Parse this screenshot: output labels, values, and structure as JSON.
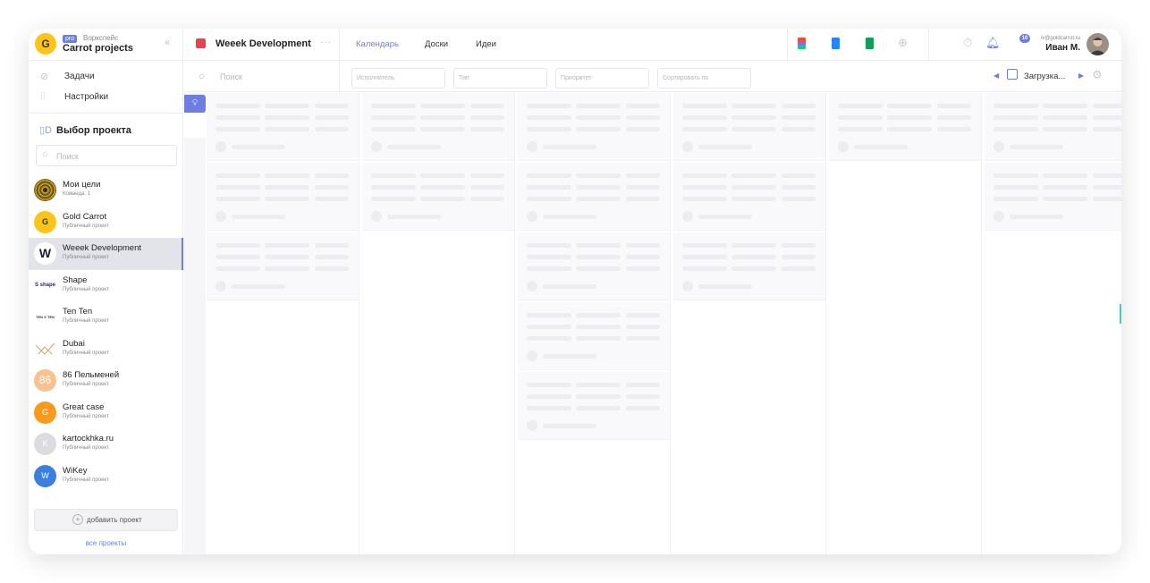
{
  "workspace": {
    "badge": "pro",
    "label": "Воркспейс",
    "name": "Carrot projects",
    "logo_letter": "G",
    "logo_color": "#fcc419"
  },
  "nav": [
    {
      "label": "Задачи",
      "icon": "check-circle-icon"
    },
    {
      "label": "Настройки",
      "icon": "sliders-icon"
    }
  ],
  "projects_section": {
    "title": "Выбор проекта",
    "search_placeholder": "Поиск"
  },
  "projects": [
    {
      "name": "Мои цели",
      "subtitle": "Команда: 1",
      "avatar_text": "",
      "avatar_color": "#3a3010"
    },
    {
      "name": "Gold Carrot",
      "subtitle": "Публичный проект",
      "avatar_text": "G",
      "avatar_color": "#fcc419"
    },
    {
      "name": "Weeek Development",
      "subtitle": "Публичный проект",
      "avatar_text": "W",
      "avatar_color": "#ffffff",
      "active": true
    },
    {
      "name": "Shape",
      "subtitle": "Публичный проект",
      "avatar_text": "S shape",
      "avatar_color": "#ffffff"
    },
    {
      "name": "Ten Ten",
      "subtitle": "Публичный проект",
      "avatar_text": "TEN X TEN",
      "avatar_color": "#ffffff"
    },
    {
      "name": "Dubai",
      "subtitle": "Публичный проект",
      "avatar_text": "",
      "avatar_color": "#ffffff"
    },
    {
      "name": "86 Пельменей",
      "subtitle": "Публичный проект",
      "avatar_text": "86",
      "avatar_color": "#f7c28f"
    },
    {
      "name": "Great case",
      "subtitle": "Публичный проект",
      "avatar_text": "G",
      "avatar_color": "#f99a1c"
    },
    {
      "name": "kartockhka.ru",
      "subtitle": "Публичный проект",
      "avatar_text": "K",
      "avatar_color": "#dcdce0"
    },
    {
      "name": "WiKey",
      "subtitle": "Публичный проект",
      "avatar_text": "W",
      "avatar_color": "#3b7fe0"
    }
  ],
  "sidebar_footer": {
    "add_project": "добавить проект",
    "all_projects": "все проекты"
  },
  "topbar": {
    "project_title": "Weeek Development",
    "project_color": "#e8414f",
    "more": "···",
    "tabs": [
      {
        "label": "Календарь",
        "active": true
      },
      {
        "label": "Доски",
        "active": false
      },
      {
        "label": "Идеи",
        "active": false
      }
    ],
    "notification_count": "10",
    "user_email": "iv@goldcarrot.ru",
    "user_name": "Иван М."
  },
  "filters": {
    "search_placeholder": "Поиск",
    "assignee": "Исполнитель",
    "type": "Тип",
    "priority": "Приоритет",
    "sort": "Сортировать по",
    "loading_label": "Загрузка..."
  },
  "colors": {
    "accent": "#6c7ee1",
    "danger": "#e8414f"
  }
}
